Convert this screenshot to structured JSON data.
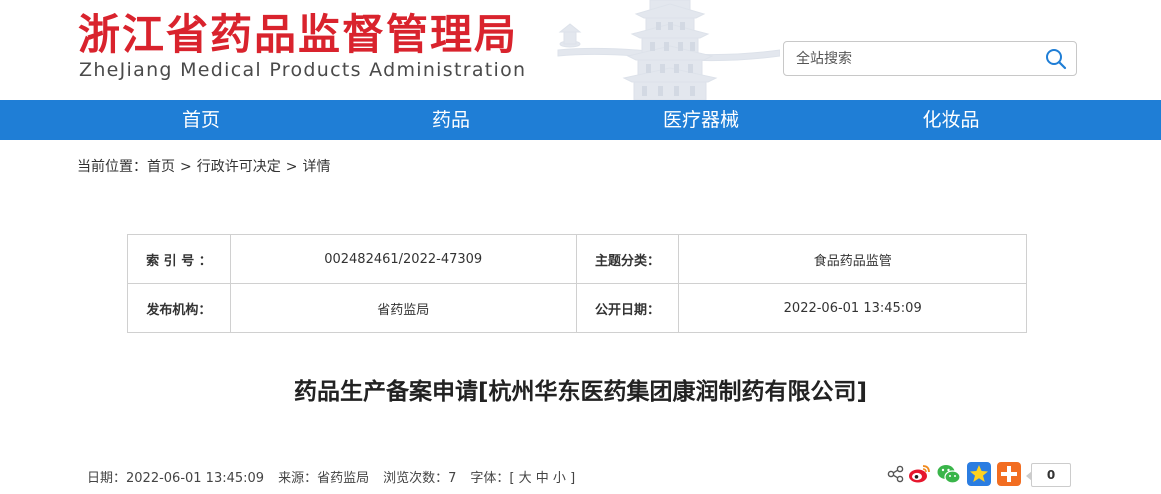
{
  "header": {
    "title_cn": "浙江省药品监督管理局",
    "title_en": "ZheJiang Medical Products Administration",
    "brand_color": "#d9232d"
  },
  "search": {
    "placeholder": "全站搜索",
    "icon": "search-icon"
  },
  "nav": {
    "color": "#1f7ed6",
    "items": [
      {
        "label": "首页"
      },
      {
        "label": "药品"
      },
      {
        "label": "医疗器械"
      },
      {
        "label": "化妆品"
      }
    ]
  },
  "breadcrumb": {
    "prefix": "当前位置：",
    "items": [
      "首页",
      "行政许可决定",
      "详情"
    ],
    "separator": ">"
  },
  "meta": {
    "index_label": "索 引 号 ：",
    "index_value": "002482461/2022-47309",
    "topic_label": "主题分类：",
    "topic_value": "食品药品监管",
    "publisher_label": "发布机构：",
    "publisher_value": "省药监局",
    "date_label": "公开日期：",
    "date_value": "2022-06-01 13:45:09"
  },
  "article": {
    "title": "药品生产备案申请[杭州华东医药集团康润制药有限公司]"
  },
  "info": {
    "date": "日期：2022-06-01 13:45:09",
    "source": "来源：省药监局",
    "views": "浏览次数：7",
    "font_label": "字体：[",
    "font_large": "大",
    "font_medium": "中",
    "font_small": "小",
    "font_end": "]"
  },
  "share": {
    "icons": [
      "share-icon",
      "weibo-icon",
      "wechat-icon",
      "qzone-icon",
      "more-icon"
    ],
    "count": "0"
  }
}
